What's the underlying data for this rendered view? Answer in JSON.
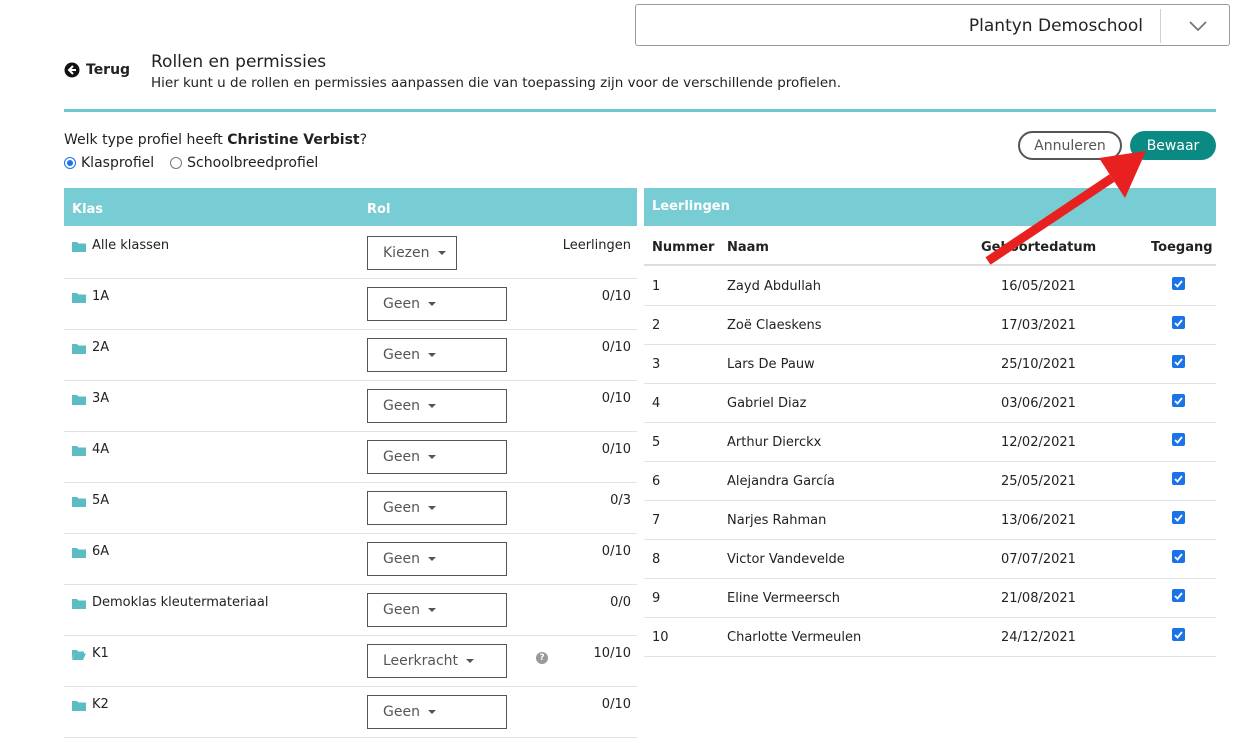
{
  "school_selector": {
    "value": "Plantyn Demoschool"
  },
  "header": {
    "back_label": "Terug",
    "title": "Rollen en permissies",
    "subtitle": "Hier kunt u de rollen en permissies aanpassen die van toepassing zijn voor de verschillende profielen."
  },
  "profile": {
    "question_prefix": "Welk type profiel heeft ",
    "person": "Christine Verbist",
    "question_suffix": "?",
    "options": [
      "Klasprofiel",
      "Schoolbreedprofiel"
    ],
    "selected": "Klasprofiel"
  },
  "actions": {
    "cancel_label": "Annuleren",
    "save_label": "Bewaar"
  },
  "classes_table": {
    "headers": {
      "klas": "Klas",
      "rol": "Rol"
    },
    "leerlingen_label": "Leerlingen",
    "rows": [
      {
        "name": "Alle klassen",
        "role": "Kiezen",
        "count": ""
      },
      {
        "name": "1A",
        "role": "Geen",
        "count": "0/10"
      },
      {
        "name": "2A",
        "role": "Geen",
        "count": "0/10"
      },
      {
        "name": "3A",
        "role": "Geen",
        "count": "0/10"
      },
      {
        "name": "4A",
        "role": "Geen",
        "count": "0/10"
      },
      {
        "name": "5A",
        "role": "Geen",
        "count": "0/3"
      },
      {
        "name": "6A",
        "role": "Geen",
        "count": "0/10"
      },
      {
        "name": "Demoklas kleutermateriaal",
        "role": "Geen",
        "count": "0/0"
      },
      {
        "name": "K1",
        "role": "Leerkracht",
        "count": "10/10"
      },
      {
        "name": "K2",
        "role": "Geen",
        "count": "0/10"
      }
    ]
  },
  "students_table": {
    "title": "Leerlingen",
    "columns": {
      "nummer": "Nummer",
      "naam": "Naam",
      "geboortedatum": "Geboortedatum",
      "toegang": "Toegang"
    },
    "rows": [
      {
        "nummer": "1",
        "naam": "Zayd Abdullah",
        "geboortedatum": "16/05/2021",
        "toegang": true
      },
      {
        "nummer": "2",
        "naam": "Zoë Claeskens",
        "geboortedatum": "17/03/2021",
        "toegang": true
      },
      {
        "nummer": "3",
        "naam": "Lars De Pauw",
        "geboortedatum": "25/10/2021",
        "toegang": true
      },
      {
        "nummer": "4",
        "naam": "Gabriel Diaz",
        "geboortedatum": "03/06/2021",
        "toegang": true
      },
      {
        "nummer": "5",
        "naam": "Arthur Dierckx",
        "geboortedatum": "12/02/2021",
        "toegang": true
      },
      {
        "nummer": "6",
        "naam": "Alejandra García",
        "geboortedatum": "25/05/2021",
        "toegang": true
      },
      {
        "nummer": "7",
        "naam": "Narjes Rahman",
        "geboortedatum": "13/06/2021",
        "toegang": true
      },
      {
        "nummer": "8",
        "naam": "Victor Vandevelde",
        "geboortedatum": "07/07/2021",
        "toegang": true
      },
      {
        "nummer": "9",
        "naam": "Eline Vermeersch",
        "geboortedatum": "21/08/2021",
        "toegang": true
      },
      {
        "nummer": "10",
        "naam": "Charlotte Vermeulen",
        "geboortedatum": "24/12/2021",
        "toegang": true
      }
    ]
  },
  "colors": {
    "teal_header": "#78ccd3",
    "save_button": "#0b8a83",
    "annotation_arrow": "#e8201f",
    "checkbox": "#1a73e8"
  }
}
